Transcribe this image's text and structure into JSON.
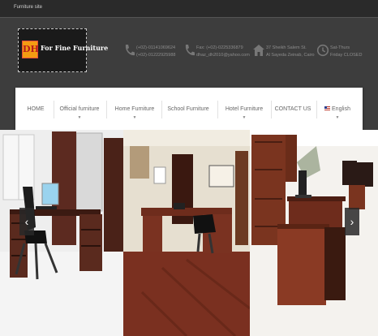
{
  "site": {
    "title": "Furniture site"
  },
  "brand": {
    "mark": "DH",
    "name": "For Fine Furniture"
  },
  "contacts": [
    {
      "icon": "phone-icon",
      "line1": "(+02)-01141069624",
      "line2": "(+02)-01222925988"
    },
    {
      "icon": "fax-icon",
      "line1": "Fax: (+02)-0225336879",
      "line2": "dhaz_dh2010@yahoo.com"
    },
    {
      "icon": "home-icon",
      "line1": "37 Sheikh Salem St.",
      "line2": "Al Sayeda Zeinab, Cairo"
    },
    {
      "icon": "clock-icon",
      "line1": "Sat-Thurs",
      "line2": "Friday CLOSED"
    }
  ],
  "nav": {
    "home": "HOME",
    "official": "Official furniture",
    "home_furniture": "Home Furniture",
    "school": "School Furniture",
    "hotel": "Hotel Furniture",
    "contact": "CONTACT US",
    "language": "English",
    "caret": "▼"
  },
  "slider": {
    "prev": "‹",
    "next": "›"
  },
  "colors": {
    "topbar": "#2a2a2a",
    "header": "#3d3d3d",
    "logo_accent": "#f39c12",
    "nav_bg": "#ffffff"
  }
}
